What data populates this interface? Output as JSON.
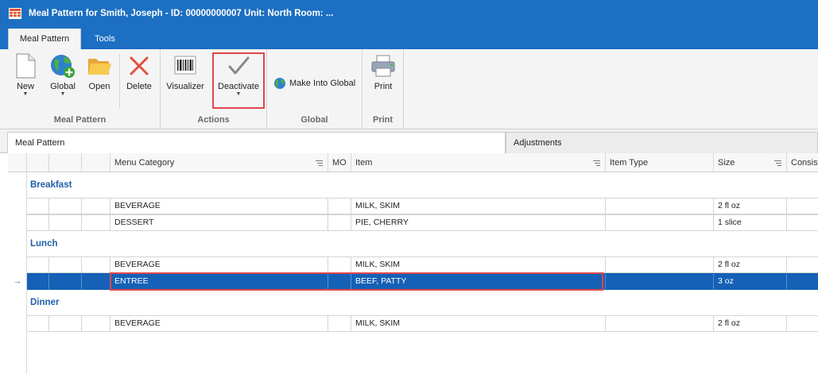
{
  "window": {
    "title": "Meal Pattern for Smith, Joseph - ID: 00000000007 Unit: North Room: ..."
  },
  "ribbon": {
    "tabs": [
      {
        "label": "Meal Pattern",
        "active": true
      },
      {
        "label": "Tools",
        "active": false
      }
    ],
    "groups": {
      "meal_pattern": {
        "label": "Meal Pattern",
        "new_label": "New",
        "global_label": "Global",
        "open_label": "Open",
        "delete_label": "Delete"
      },
      "actions": {
        "label": "Actions",
        "visualizer_label": "Visualizer",
        "deactivate_label": "Deactivate"
      },
      "global": {
        "label": "Global",
        "make_global_label": "Make Into Global"
      },
      "print": {
        "label": "Print",
        "print_label": "Print"
      }
    }
  },
  "panes": {
    "meal_pattern_label": "Meal Pattern",
    "adjustments_label": "Adjustments"
  },
  "grid": {
    "columns": {
      "menu_category": "Menu Category",
      "mo": "MO",
      "item": "Item",
      "item_type": "Item Type",
      "size": "Size",
      "consistency": "Consist"
    },
    "groups": [
      {
        "name": "Breakfast",
        "rows": [
          {
            "menu_category": "BEVERAGE",
            "item": "MILK, SKIM",
            "size": "2 fl oz"
          },
          {
            "menu_category": "DESSERT",
            "item": "PIE, CHERRY",
            "size": "1 slice"
          }
        ]
      },
      {
        "name": "Lunch",
        "rows": [
          {
            "menu_category": "BEVERAGE",
            "item": "MILK, SKIM",
            "size": "2 fl oz"
          },
          {
            "menu_category": "ENTREE",
            "item": "BEEF, PATTY",
            "size": "3 oz",
            "selected": true
          }
        ]
      },
      {
        "name": "Dinner",
        "rows": [
          {
            "menu_category": "BEVERAGE",
            "item": "MILK, SKIM",
            "size": "2 fl oz"
          }
        ]
      }
    ],
    "row_indicator": "→"
  },
  "colors": {
    "title_bar": "#1c6fc2",
    "selection": "#1461b7",
    "group_text": "#1f5fa8",
    "highlight": "#e0464b"
  }
}
